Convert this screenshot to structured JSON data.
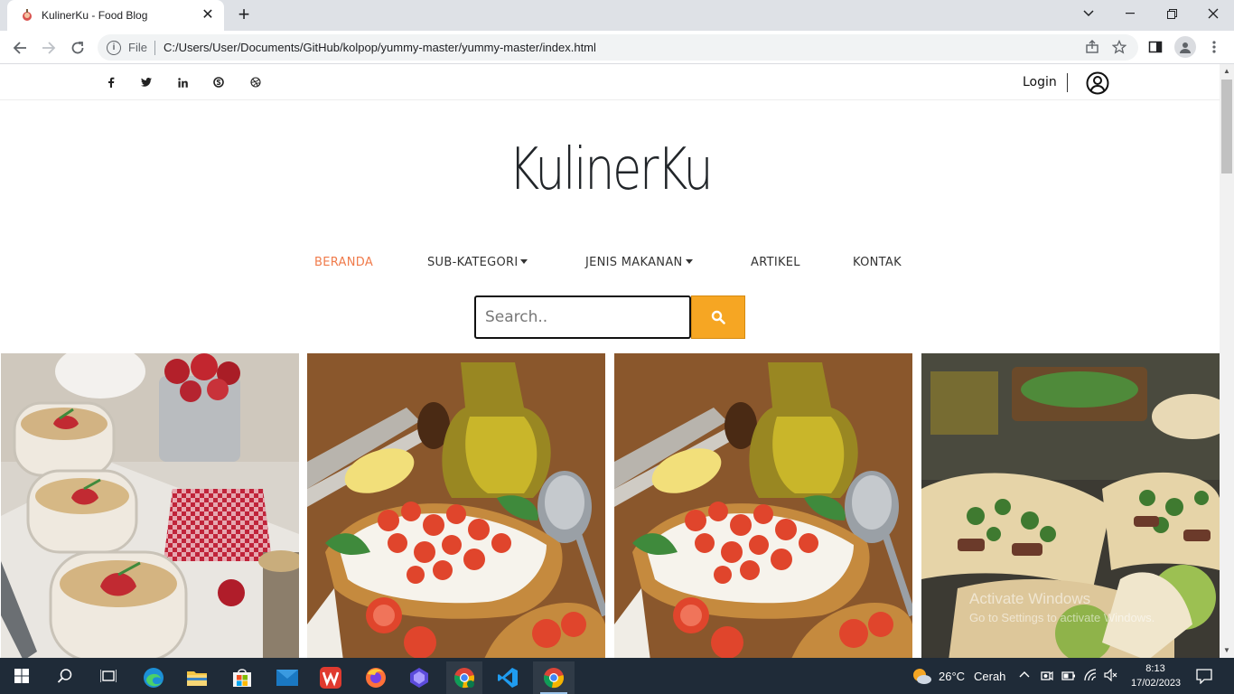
{
  "browser": {
    "tab_title": "KulinerKu - Food Blog",
    "address_prefix": "File",
    "url": "C:/Users/User/Documents/GitHub/kolpop/yummy-master/yummy-master/index.html"
  },
  "topbar": {
    "social_icons": [
      "facebook-icon",
      "twitter-icon",
      "linkedin-icon",
      "skype-icon",
      "dribbble-icon"
    ],
    "login_label": "Login"
  },
  "brand": "KulinerKu",
  "nav": {
    "beranda": "BERANDA",
    "sub_kategori": "SUB-KATEGORI",
    "jenis_makanan": "JENIS MAKANAN",
    "artikel": "ARTIKEL",
    "kontak": "KONTAK"
  },
  "search": {
    "placeholder": "Search.."
  },
  "gallery": [
    "oats-strawberry-photo",
    "bruschetta-photo",
    "bruschetta-photo",
    "tacos-photo"
  ],
  "watermark": {
    "line1": "Activate Windows",
    "line2": "Go to Settings to activate Windows."
  },
  "taskbar": {
    "weather_temp": "26°C",
    "weather_desc": "Cerah",
    "time": "8:13",
    "date": "17/02/2023"
  },
  "colors": {
    "accent_nav": "#f07b4b",
    "search_button": "#f6a623",
    "taskbar": "#1f2b38"
  }
}
